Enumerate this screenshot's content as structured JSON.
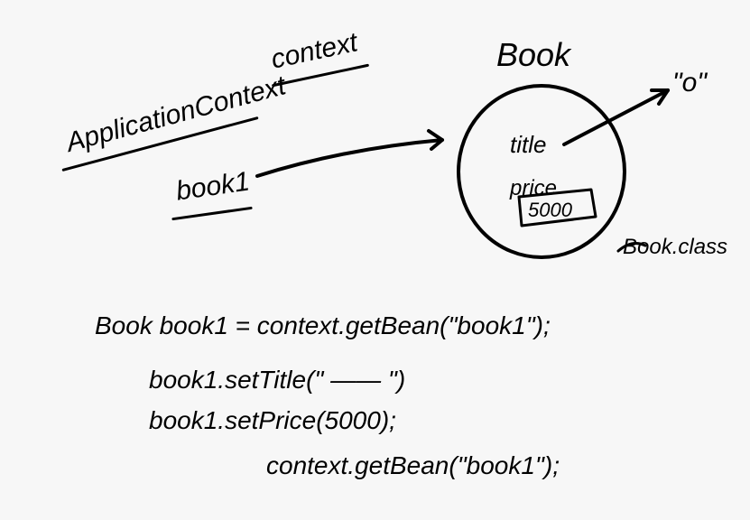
{
  "diagram": {
    "title_app_context": "ApplicationContext",
    "title_context": "context",
    "book1_label": "book1",
    "book_class": "Book",
    "book_class_label": "Book.class",
    "field_title": "title",
    "field_price": "price",
    "price_value": "5000",
    "title_value": "\"o\"",
    "code_line1": "Book book1 = context.getBean(\"book1\");",
    "code_line2": "book1.setTitle(\" —— \")",
    "code_line3": "book1.setPrice(5000);",
    "code_line4": "context.getBean(\"book1\");"
  }
}
